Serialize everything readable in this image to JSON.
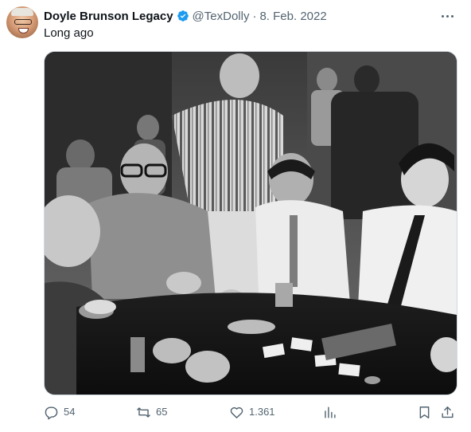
{
  "tweet": {
    "author_name": "Doyle Brunson Legacy",
    "handle": "@TexDolly",
    "separator": "·",
    "date": "8. Feb. 2022",
    "text": "Long ago",
    "verified_color": "#1d9bf0"
  },
  "actions": {
    "reply_count": "54",
    "retweet_count": "65",
    "like_count": "1.361"
  },
  "icons": {
    "more": "more-icon",
    "reply": "reply-icon",
    "retweet": "retweet-icon",
    "like": "heart-icon",
    "views": "views-icon",
    "bookmark": "bookmark-icon",
    "share": "share-icon"
  }
}
